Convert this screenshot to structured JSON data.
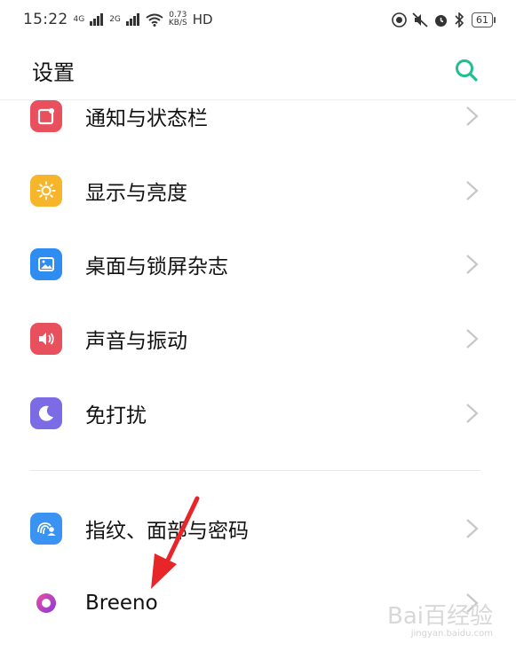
{
  "status_bar": {
    "time": "15:22",
    "network_1": "4G",
    "network_2": "2G",
    "speed_value": "0.73",
    "speed_unit": "KB/S",
    "hd": "HD",
    "battery": "61"
  },
  "header": {
    "title": "设置",
    "search_icon": "search-icon"
  },
  "items": [
    {
      "label": "通知与状态栏",
      "icon": "notification-icon",
      "color": "#e9505d"
    },
    {
      "label": "显示与亮度",
      "icon": "brightness-icon",
      "color": "#f7b52c"
    },
    {
      "label": "桌面与锁屏杂志",
      "icon": "wallpaper-icon",
      "color": "#2f8cf0"
    },
    {
      "label": "声音与振动",
      "icon": "volume-icon",
      "color": "#e9505d"
    },
    {
      "label": "免打扰",
      "icon": "moon-icon",
      "color": "#7b6be5"
    },
    {
      "label": "指纹、面部与密码",
      "icon": "fingerprint-face-icon",
      "color": "#3a93f0"
    },
    {
      "label": "Breeno",
      "icon": "breeno-icon",
      "color": "#c23acb"
    }
  ],
  "colors": {
    "accent": "#1fbf8f",
    "chevron": "#c7c7c7",
    "annotation_arrow": "#e8262a"
  },
  "watermark": {
    "text": "Bai百经验",
    "sub": "jingyan.baidu.com"
  }
}
